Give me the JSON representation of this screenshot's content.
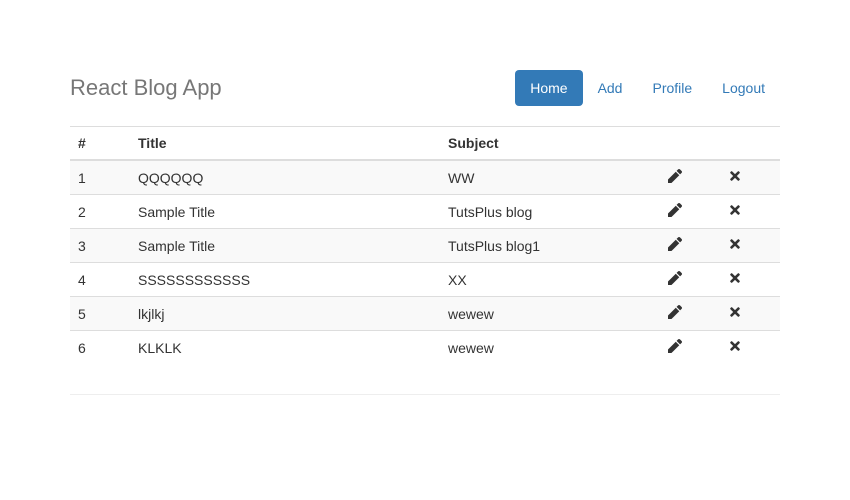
{
  "header": {
    "brand": "React Blog App",
    "nav": {
      "home": "Home",
      "add": "Add",
      "profile": "Profile",
      "logout": "Logout"
    }
  },
  "table": {
    "headers": {
      "idx": "#",
      "title": "Title",
      "subject": "Subject"
    },
    "rows": [
      {
        "idx": "1",
        "title": "QQQQQQ",
        "subject": "WW"
      },
      {
        "idx": "2",
        "title": "Sample Title",
        "subject": "TutsPlus blog"
      },
      {
        "idx": "3",
        "title": "Sample Title",
        "subject": "TutsPlus blog1"
      },
      {
        "idx": "4",
        "title": "SSSSSSSSSSSS",
        "subject": "XX"
      },
      {
        "idx": "5",
        "title": "lkjlkj",
        "subject": "wewew"
      },
      {
        "idx": "6",
        "title": "KLKLK",
        "subject": "wewew"
      }
    ]
  }
}
